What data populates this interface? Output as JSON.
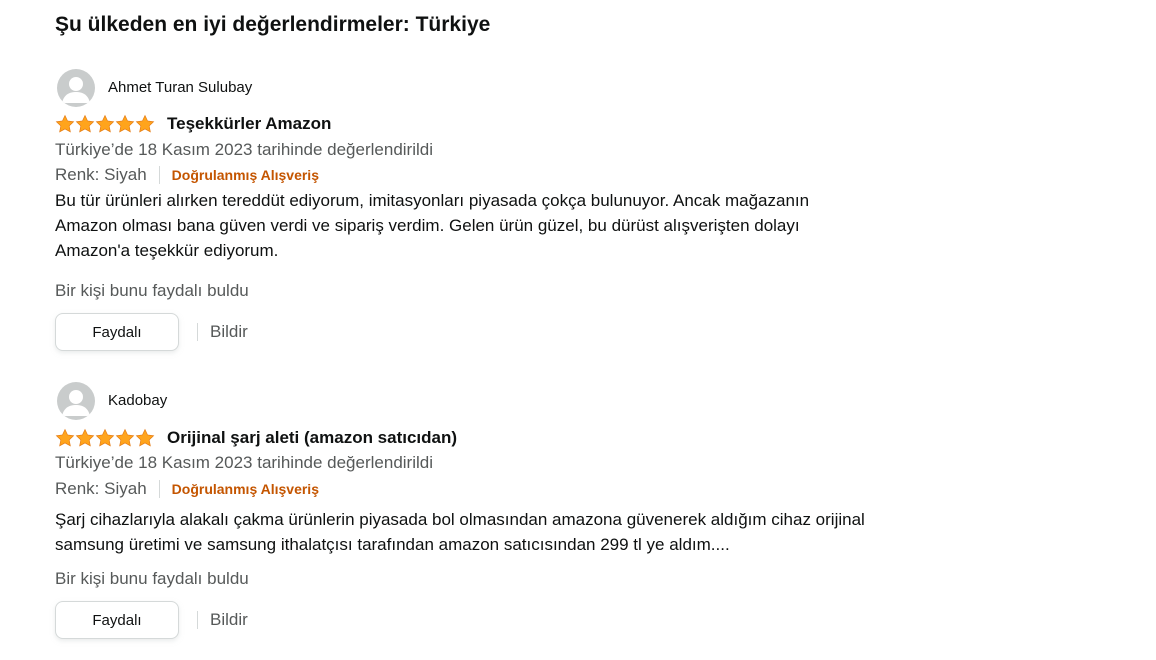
{
  "heading": "Şu ülkeden en iyi değerlendirmeler: Türkiye",
  "colors": {
    "star": "#ffa41c",
    "verified": "#c45500",
    "muted": "#565959"
  },
  "reviews": [
    {
      "reviewer": "Ahmet Turan Sulubay",
      "rating": 5,
      "title": "Teşekkürler Amazon",
      "date": "Türkiye’de 18 Kasım 2023 tarihinde değerlendirildi",
      "variant": "Renk: Siyah",
      "verified": "Doğrulanmış Alışveriş",
      "body_lines": [
        "Bu tür ürünleri alırken tereddüt ediyorum, imitasyonları piyasada çokça bulunuyor. Ancak mağazanın",
        "Amazon olması bana güven verdi ve sipariş verdim. Gelen ürün güzel, bu dürüst alışverişten dolayı",
        "Amazon'a teşekkür ediyorum."
      ],
      "helpful": "Bir kişi bunu faydalı buldu",
      "helpful_button": "Faydalı",
      "report": "Bildir"
    },
    {
      "reviewer": "Kadobay",
      "rating": 5,
      "title": "Orijinal şarj aleti (amazon satıcıdan)",
      "date": "Türkiye’de 18 Kasım 2023 tarihinde değerlendirildi",
      "variant": "Renk: Siyah",
      "verified": "Doğrulanmış Alışveriş",
      "body_lines": [
        "Şarj cihazlarıyla alakalı çakma ürünlerin piyasada bol olmasından amazona güvenerek aldığım cihaz orijinal",
        "samsung üretimi ve samsung ithalatçısı tarafından amazon satıcısından 299 tl ye aldım...."
      ],
      "helpful": "Bir kişi bunu faydalı buldu",
      "helpful_button": "Faydalı",
      "report": "Bildir"
    }
  ]
}
